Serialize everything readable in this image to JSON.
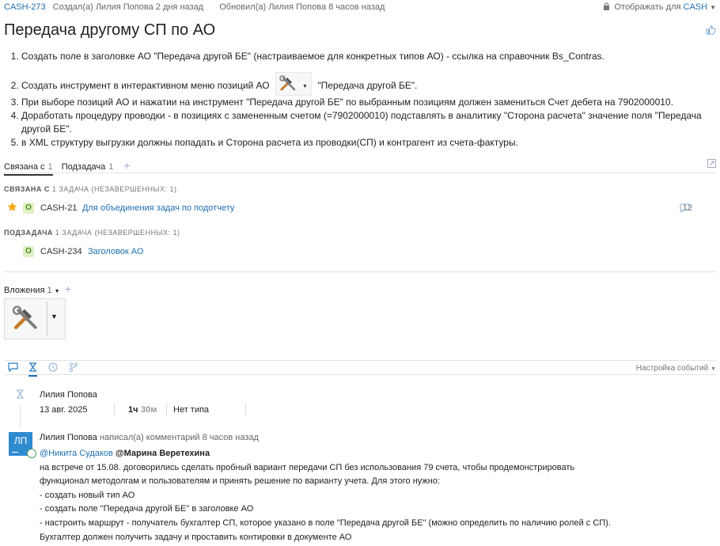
{
  "header": {
    "issue_key": "CASH-273",
    "created": "Создал(а) Лилия Попова 2 дня назад",
    "updated": "Обновил(а) Лилия Попова 8 часов назад",
    "visibility_prefix": "Отображать для",
    "visibility_value": "CASH"
  },
  "title": "Передача другому СП по АО",
  "description": {
    "items": [
      "Создать поле в заголовке АО \"Передача другой БЕ\" (настраиваемое для конкретных типов АО) - ссылка на справочник Bs_Contras.",
      "Создать инструмент в интерактивном меню позиций АО",
      "\"Передача другой БЕ\".",
      "При выборе позиций АО и нажатии на инструмент \"Передача другой БЕ\" по выбранным позициям должен замениться Счет дебета на 7902000010.",
      "Доработать процедуру проводки - в позициях с замененным счетом (=7902000010) подставлять в аналитику \"Сторона расчета\" значение поля \"Передача",
      "другой БЕ\".",
      "в XML структуру выгрузки должны попадать и Сторона расчета из проводки(СП) и контрагент из счета-фактуры."
    ]
  },
  "tabs": [
    {
      "label": "Связана с",
      "count": "1"
    },
    {
      "label": "Подзадача",
      "count": "1"
    }
  ],
  "related": {
    "heading": "СВЯЗАНА С",
    "summary": "1 ЗАДАЧА (НЕЗАВЕРШЕННЫХ: 1)",
    "status_letter": "О",
    "key": "CASH-21",
    "title": "Для объединения задач по подотчету",
    "comments": "12"
  },
  "subtask": {
    "heading": "ПОДЗАДАЧА",
    "summary": "1 ЗАДАЧА (НЕЗАВЕРШЕННЫХ: 1)",
    "status_letter": "О",
    "key": "CASH-234",
    "title": "Заголовок АО"
  },
  "attachments": {
    "label": "Вложения",
    "count": "1"
  },
  "activity": {
    "settings_label": "Настройка событий"
  },
  "worklog": {
    "author": "Лилия Попова",
    "date": "13 авг. 2025",
    "hours": "1ч",
    "minutes": "30м",
    "type": "Нет типа"
  },
  "comment": {
    "avatar_initials": "ЛП",
    "author": "Лилия Попова",
    "meta": "написал(а) комментарий 8 часов назад",
    "mention1": "@Никита Судаков",
    "mention2": "@Марина Веретехина",
    "lines": [
      "на встрече от 15.08. договорились сделать пробный вариант передачи СП без использования 79 счета, чтобы продемонстрировать",
      "функционал методолгам и пользователям и принять решение по варианту учета. Для этого нужно:",
      "- создать новый тип АО",
      "- создать поле \"Передача другой БЕ\" в заголовке АО",
      "- настроить маршрут - получатель бухгалтер СП, которое указано в поле \"Передача другой БЕ\" (можно определить по наличию ролей с СП).",
      "Бухгалтер должен получить задачу и проставить контировки в документе АО"
    ]
  },
  "colors": {
    "link": "#1f6fb2",
    "star": "#f2a60c",
    "status_bg": "#dff0c4",
    "avatar": "#2e8bd0"
  }
}
